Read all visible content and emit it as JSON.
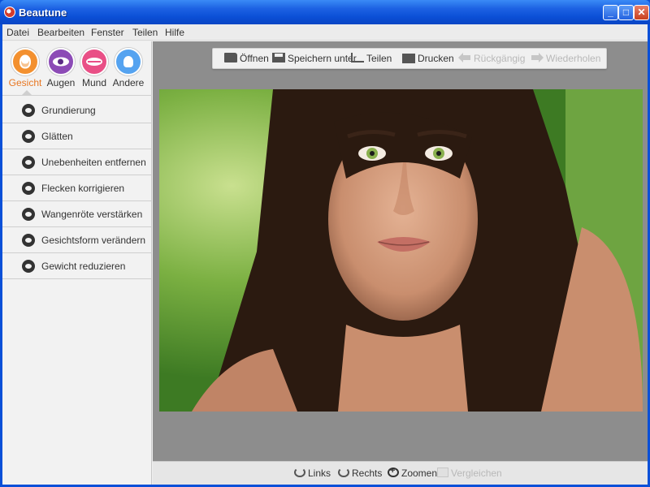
{
  "window": {
    "title": "Beautune",
    "minimize_glyph": "_",
    "maximize_glyph": "□",
    "close_glyph": "✕"
  },
  "menu": [
    "Datei",
    "Bearbeiten",
    "Fenster",
    "Teilen",
    "Hilfe"
  ],
  "categories": [
    {
      "label": "Gesicht",
      "icon": "face-icon",
      "active": true,
      "color": "#f3902f"
    },
    {
      "label": "Augen",
      "icon": "eye-icon",
      "active": false,
      "color": "#8c4bb6"
    },
    {
      "label": "Mund",
      "icon": "lips-icon",
      "active": false,
      "color": "#e94f86"
    },
    {
      "label": "Andere",
      "icon": "flower-icon",
      "active": false,
      "color": "#55a3f0"
    }
  ],
  "tools": [
    {
      "label": "Grundierung",
      "icon": "foundation-icon"
    },
    {
      "label": "Glätten",
      "icon": "smooth-icon"
    },
    {
      "label": "Unebenheiten entfernen",
      "icon": "blemish-icon"
    },
    {
      "label": "Flecken korrigieren",
      "icon": "spot-icon"
    },
    {
      "label": "Wangenröte verstärken",
      "icon": "blush-icon"
    },
    {
      "label": "Gesichtsform verändern",
      "icon": "face-shape-icon"
    },
    {
      "label": "Gewicht reduzieren",
      "icon": "weight-icon"
    }
  ],
  "toolbar": {
    "open": "Öffnen",
    "save_as": "Speichern unter",
    "share": "Teilen",
    "print": "Drucken",
    "undo": "Rückgängig",
    "redo": "Wiederholen"
  },
  "bottombar": {
    "rotate_left": "Links",
    "rotate_right": "Rechts",
    "zoom": "Zoomen",
    "compare": "Vergleichen"
  },
  "colors": {
    "accent": "#e87722",
    "title_bar": "#0b4fd6",
    "workspace": "#8d8d8d"
  }
}
